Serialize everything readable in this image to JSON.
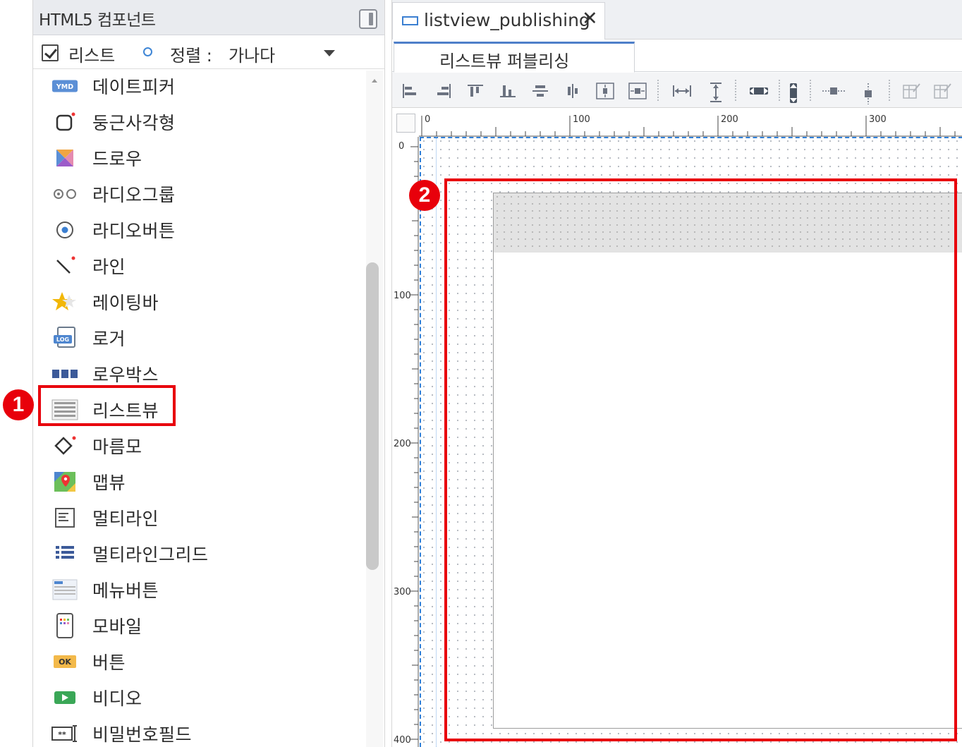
{
  "left_panel": {
    "title": "HTML5 컴포넌트",
    "toolbar": {
      "list_label": "리스트",
      "list_checked": true,
      "sort_label": "정렬 :",
      "sort_value": "가나다"
    },
    "items": [
      {
        "label": "데이트피커",
        "icon": "datepicker-icon"
      },
      {
        "label": "둥근사각형",
        "icon": "rounded-rect-icon"
      },
      {
        "label": "드로우",
        "icon": "draw-icon"
      },
      {
        "label": "라디오그룹",
        "icon": "radio-group-icon"
      },
      {
        "label": "라디오버튼",
        "icon": "radio-button-icon"
      },
      {
        "label": "라인",
        "icon": "line-icon"
      },
      {
        "label": "레이팅바",
        "icon": "rating-bar-icon"
      },
      {
        "label": "로거",
        "icon": "logger-icon"
      },
      {
        "label": "로우박스",
        "icon": "rowbox-icon"
      },
      {
        "label": "리스트뷰",
        "icon": "listview-icon"
      },
      {
        "label": "마름모",
        "icon": "diamond-icon"
      },
      {
        "label": "맵뷰",
        "icon": "mapview-icon"
      },
      {
        "label": "멀티라인",
        "icon": "multiline-icon"
      },
      {
        "label": "멀티라인그리드",
        "icon": "multiline-grid-icon"
      },
      {
        "label": "메뉴버튼",
        "icon": "menu-button-icon"
      },
      {
        "label": "모바일",
        "icon": "mobile-icon"
      },
      {
        "label": "버튼",
        "icon": "button-icon",
        "icon_text": "OK"
      },
      {
        "label": "비디오",
        "icon": "video-icon"
      },
      {
        "label": "비밀번호필드",
        "icon": "password-field-icon"
      }
    ]
  },
  "editor": {
    "tab_title": "listview_publishing",
    "tab_close": "✕",
    "subtab_label": "리스트뷰 퍼블리싱",
    "ruler_h": [
      "0",
      "100",
      "200",
      "300"
    ],
    "ruler_v": [
      "0",
      "100",
      "200",
      "300",
      "400"
    ]
  },
  "annotations": {
    "badge_1": "1",
    "badge_2": "2",
    "color": "#e8000b"
  },
  "colors": {
    "accent": "#3b7fd1",
    "highlight": "#e8000b"
  }
}
